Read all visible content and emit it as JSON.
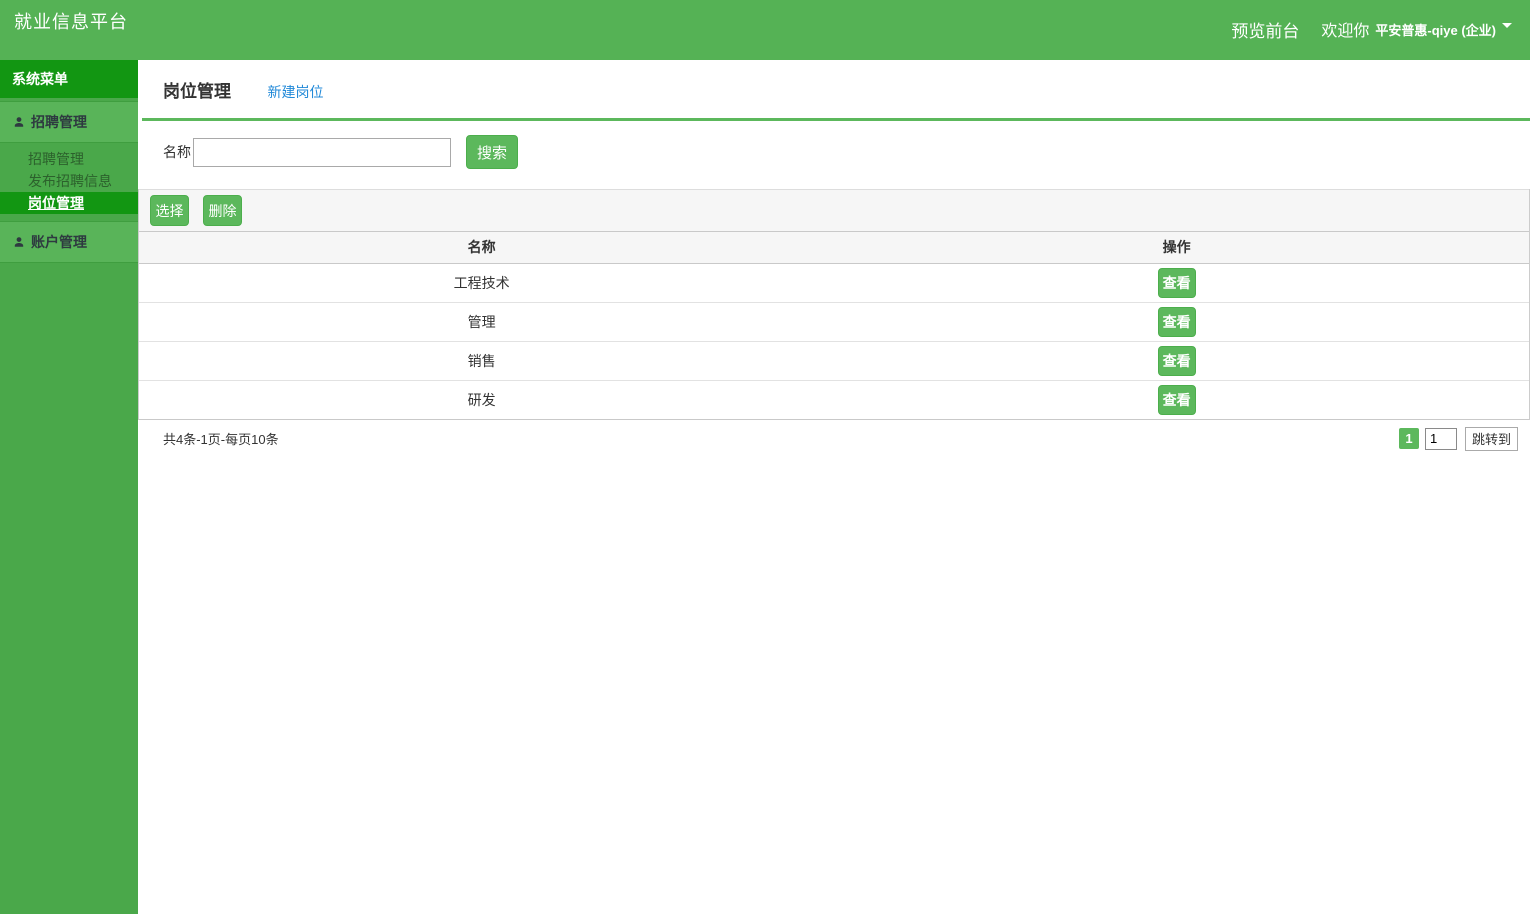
{
  "topbar": {
    "app_title": "就业信息平台",
    "preview_link": "预览前台",
    "welcome_text": "欢迎你",
    "user_name": "平安普惠-qiye (企业)"
  },
  "sidebar": {
    "menu_header": "系统菜单",
    "groups": [
      {
        "label": "招聘管理",
        "icon": "user-icon"
      },
      {
        "label": "账户管理",
        "icon": "user-icon"
      }
    ],
    "submenu": [
      {
        "label": "招聘管理",
        "active": false
      },
      {
        "label": "发布招聘信息",
        "active": false
      },
      {
        "label": "岗位管理",
        "active": true
      }
    ]
  },
  "page": {
    "title": "岗位管理",
    "new_link": "新建岗位"
  },
  "search": {
    "label": "名称",
    "input_value": "",
    "button_label": "搜索"
  },
  "toolbar": {
    "select_label": "选择",
    "delete_label": "删除"
  },
  "table": {
    "columns": [
      "名称",
      "操作"
    ],
    "rows": [
      {
        "name": "工程技术"
      },
      {
        "name": "管理"
      },
      {
        "name": "销售"
      },
      {
        "name": "研发"
      }
    ],
    "view_label": "查看"
  },
  "pagination": {
    "summary": "共4条-1页-每页10条",
    "current_page": "1",
    "jump_input_value": "1",
    "jump_label": "跳转到"
  },
  "colors": {
    "topbar_green": "#55b255",
    "sidebar_green": "#4aa84a",
    "dark_green": "#129612",
    "button_green": "#5cb85c",
    "link_blue": "#2189d8"
  }
}
